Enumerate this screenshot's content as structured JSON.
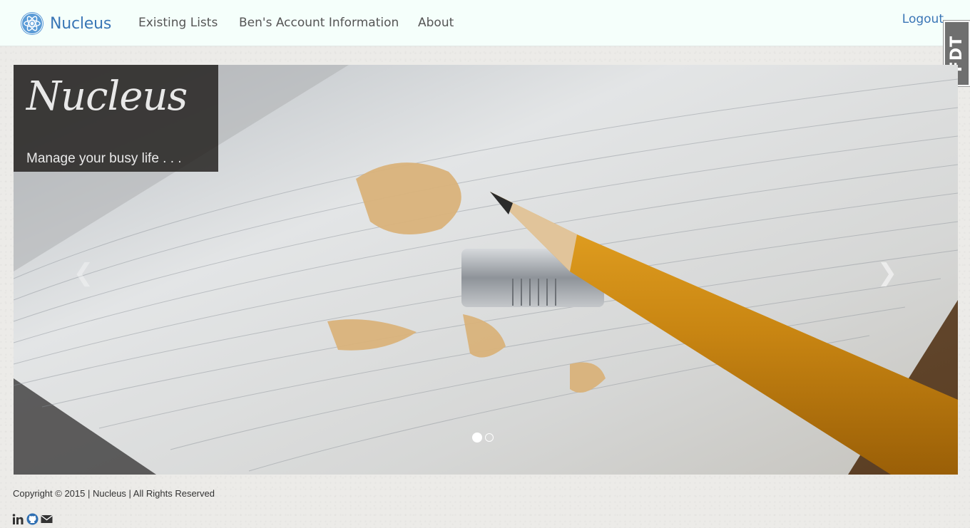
{
  "navbar": {
    "brand": "Nucleus",
    "links": [
      "Existing Lists",
      "Ben's Account Information",
      "About"
    ],
    "logout": "Logout"
  },
  "fdt_tab": "FDT",
  "carousel": {
    "caption_title": "Nucleus",
    "caption_subtitle": "Manage your busy life . . .",
    "prev_icon": "chevron-left",
    "next_icon": "chevron-right",
    "slide_count": 2,
    "active_slide": 1
  },
  "footer": {
    "copyright": "Copyright © 2015 | Nucleus | All Rights Reserved",
    "social": [
      "linkedin-icon",
      "github-icon",
      "envelope-icon"
    ]
  },
  "colors": {
    "brand": "#3a76b6",
    "navbar_bg": "#f5fffb",
    "caption_bg": "#1e1c1a"
  }
}
